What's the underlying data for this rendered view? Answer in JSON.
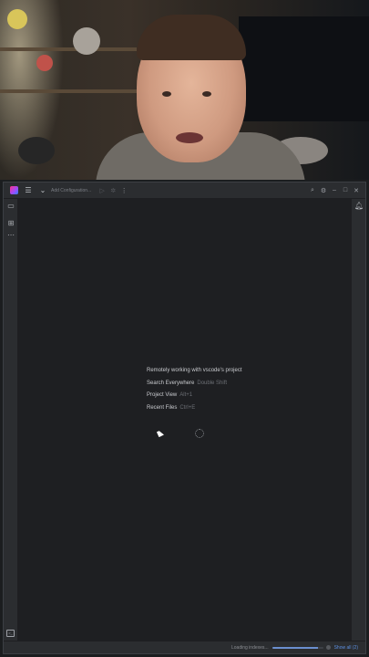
{
  "window": {
    "run_config_placeholder": "Add Configuration..."
  },
  "welcome": {
    "project_title": "Remotely working with vscode's project",
    "actions": [
      {
        "label": "Search Everywhere",
        "shortcut": "Double Shift"
      },
      {
        "label": "Project View",
        "shortcut": "Alt+1"
      },
      {
        "label": "Recent Files",
        "shortcut": "Ctrl+E"
      }
    ]
  },
  "status": {
    "indexing_text": "Loading indexes...",
    "show_all_label": "Show all (2)",
    "progress": 0.9
  },
  "icons": {
    "menu": "hamburger-menu-icon",
    "project": "folder-icon",
    "structure": "structure-icon",
    "more": "more-icon",
    "notifications": "bell-icon",
    "search": "search-icon",
    "settings": "gear-icon",
    "terminal": "terminal-icon"
  },
  "colors": {
    "editor_bg": "#1e1f22",
    "chrome_bg": "#2b2d30",
    "link": "#5c8fe0"
  }
}
